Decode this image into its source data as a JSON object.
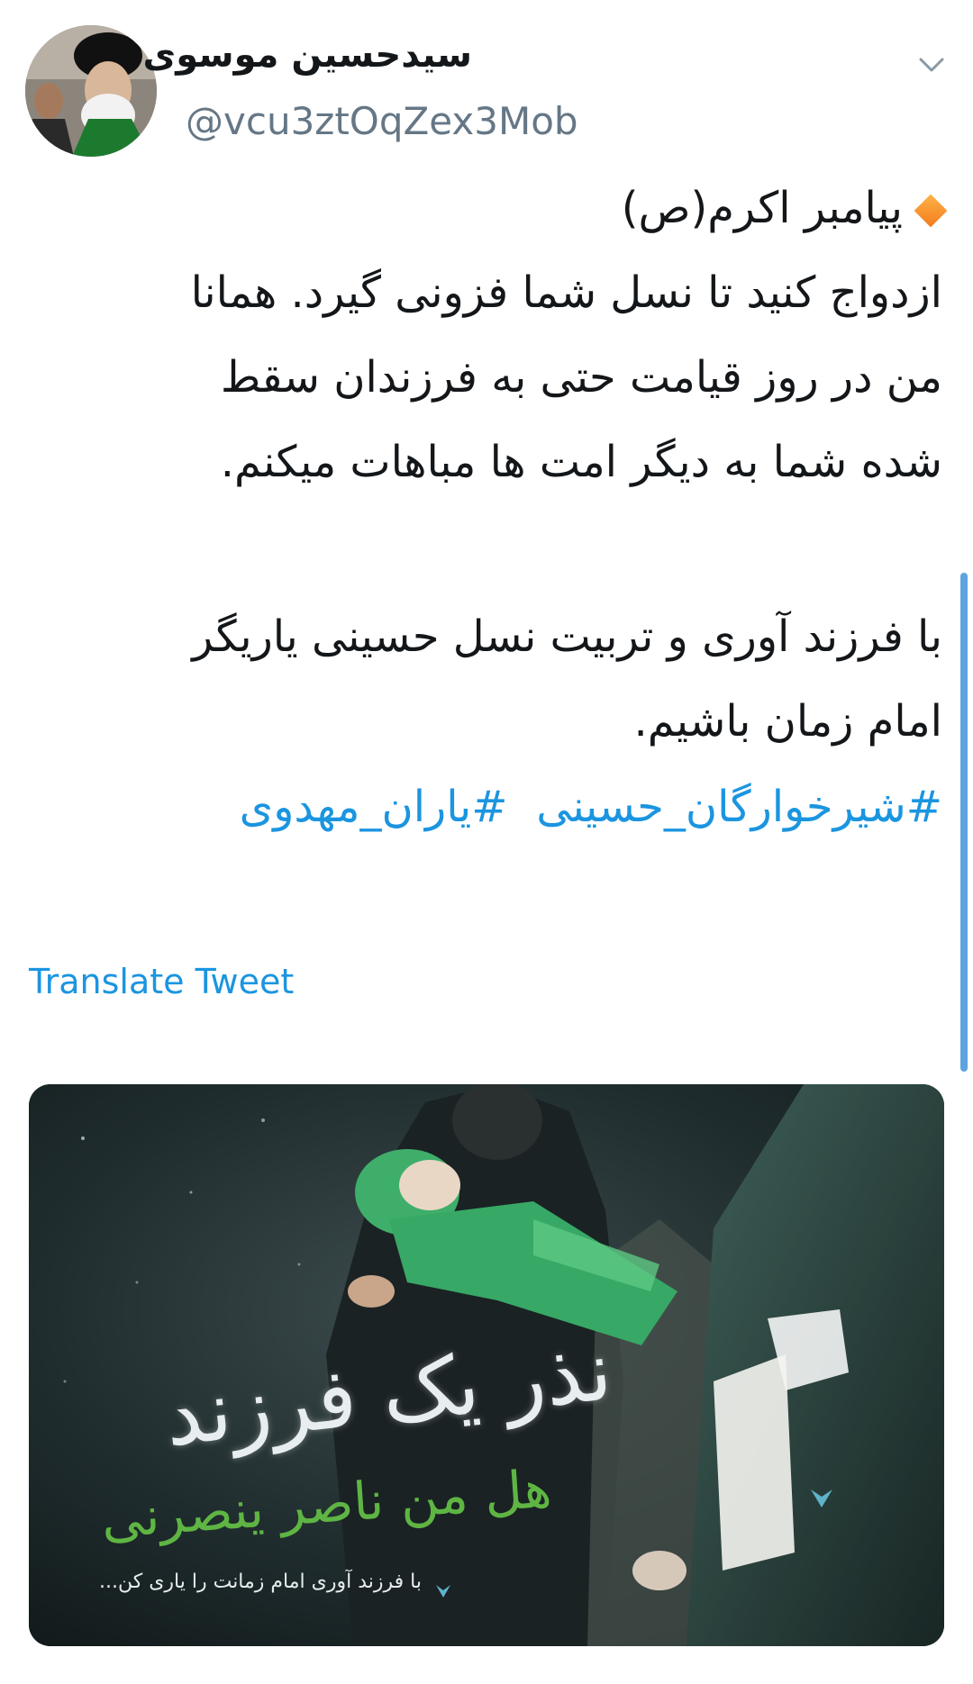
{
  "author": {
    "display_name": "سیدحسین موسوی",
    "handle": "@vcu3ztOqZex3Mob",
    "avatar_icon": "profile-photo",
    "menu_icon": "chevron-down-icon"
  },
  "tweet": {
    "intro": "پیامبر اکرم(ص)",
    "lines": [
      "ازدواج کنید تا نسل شما فزونی گیرد. همانا",
      "من در روز قیامت حتی به فرزندان سقط",
      "شده شما به دیگر امت ها مباهات میکنم."
    ],
    "lines2": [
      "با فرزند آوری و تربیت نسل حسینی یاریگر",
      "امام زمان باشیم."
    ],
    "hashtags": [
      "#شیرخوارگان_حسینی",
      "#یاران_مهدوی"
    ]
  },
  "translate_label": "Translate Tweet",
  "media": {
    "title": "نذر یک فرزند",
    "subtitle": "هل من ناصر ینصرنی",
    "caption": "با فرزند آوری امام زمانت را یاری کن..."
  },
  "colors": {
    "link": "#1b95e0",
    "handle": "#657786",
    "accent_diamond": "#f37b1d",
    "scrollbar": "#5ba4e0"
  }
}
